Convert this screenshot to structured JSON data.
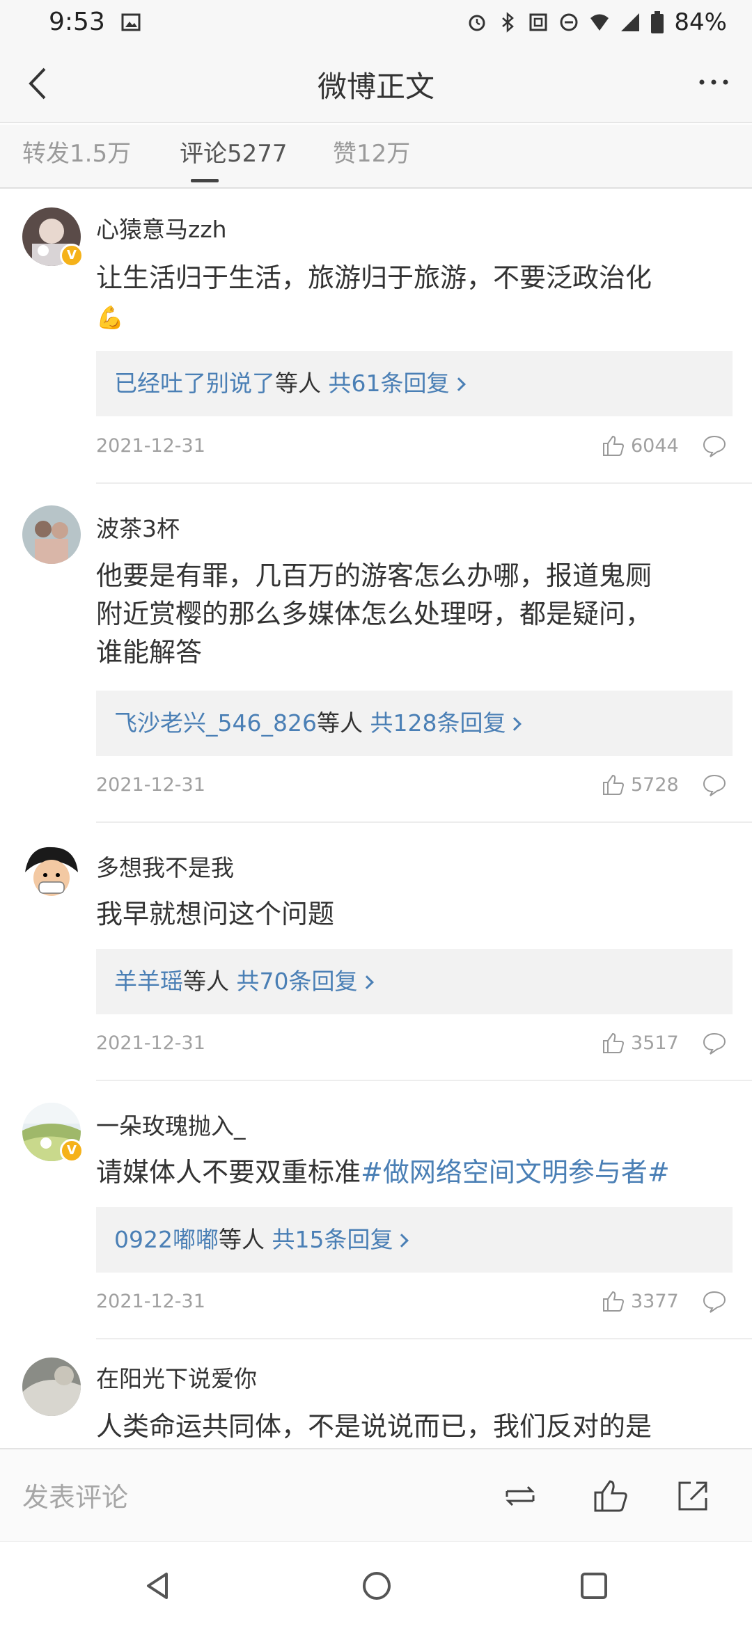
{
  "status_bar": {
    "time": "9:53",
    "battery": "84%"
  },
  "nav": {
    "title": "微博正文"
  },
  "tabs": [
    {
      "label": "转发1.5万"
    },
    {
      "label": "评论5277"
    },
    {
      "label": "赞12万"
    }
  ],
  "comments": [
    {
      "username": "心猿意马zzh",
      "text": "让生活归于生活，旅游归于旅游，不要泛政治化",
      "emoji": "💪",
      "reply_preview_user": "已经吐了别说了",
      "reply_preview_suffix": "等人",
      "reply_count": "共61条回复",
      "date": "2021-12-31",
      "likes": "6044"
    },
    {
      "username": "波茶3杯",
      "text_lines": [
        "他要是有罪，几百万的游客怎么办哪，报道鬼厕",
        "附近赏樱的那么多媒体怎么处理呀，都是疑问，",
        "谁能解答"
      ],
      "reply_preview_user": "飞沙老兴_546_826",
      "reply_preview_suffix": "等人",
      "reply_count": "共128条回复",
      "date": "2021-12-31",
      "likes": "5728"
    },
    {
      "username": "多想我不是我",
      "text": "我早就想问这个问题",
      "reply_preview_user": "羊羊瑶",
      "reply_preview_suffix": "等人",
      "reply_count": "共70条回复",
      "date": "2021-12-31",
      "likes": "3517"
    },
    {
      "username": "一朵玫瑰抛入_",
      "text": "请媒体人不要双重标准",
      "hashtag": "#做网络空间文明参与者#",
      "reply_preview_user": "0922嘟嘟",
      "reply_preview_suffix": "等人",
      "reply_count": "共15条回复",
      "date": "2021-12-31",
      "likes": "3377"
    },
    {
      "username": "在阳光下说爱你",
      "text": "人类命运共同体，不是说说而已，我们反对的是"
    }
  ],
  "bottom_bar": {
    "compose_placeholder": "发表评论"
  },
  "colors": {
    "link_blue": "#4a7fb5",
    "verified_badge": "#f5b21a",
    "muted": "#a0a0a0"
  },
  "icons": [
    "back-arrow-icon",
    "more-icon",
    "like-icon",
    "reply-icon",
    "repost-icon",
    "share-icon",
    "verified-badge-icon"
  ]
}
